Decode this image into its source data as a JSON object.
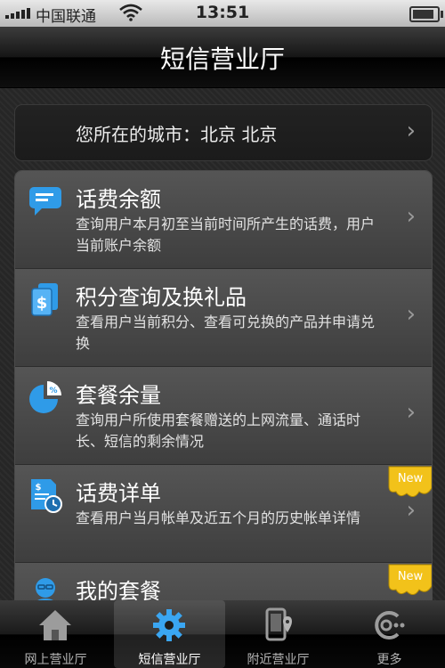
{
  "status_bar": {
    "carrier": "中国联通",
    "time": "13:51",
    "battery_level": 0.95
  },
  "nav": {
    "title": "短信营业厅"
  },
  "city": {
    "label": "您所在的城市：北京  北京"
  },
  "menu": [
    {
      "title": "话费余额",
      "desc": "查询用户本月初至当前时间所产生的话费，用户当前账户余额",
      "icon": "chat-bubble-icon",
      "new": false
    },
    {
      "title": "积分查询及换礼品",
      "desc": "查看用户当前积分、查看可兑换的产品并申请兑换",
      "icon": "dollar-cards-icon",
      "new": false
    },
    {
      "title": "套餐余量",
      "desc": "查询用户所使用套餐赠送的上网流量、通话时长、短信的剩余情况",
      "icon": "pie-chart-icon",
      "new": false
    },
    {
      "title": "话费详单",
      "desc": "查看用户当月帐单及近五个月的历史帐单详情",
      "icon": "bill-clock-icon",
      "new": true
    },
    {
      "title": "我的套餐",
      "desc": "",
      "icon": "user-avatar-icon",
      "new": true
    }
  ],
  "new_badge_text": "New",
  "tabs": [
    {
      "label": "网上营业厅",
      "icon": "home-icon",
      "active": false
    },
    {
      "label": "短信营业厅",
      "icon": "gear-icon",
      "active": true
    },
    {
      "label": "附近营业厅",
      "icon": "phone-location-icon",
      "active": false
    },
    {
      "label": "更多",
      "icon": "more-icon",
      "active": false
    }
  ],
  "colors": {
    "accent_blue": "#2f9be8",
    "badge_yellow": "#f2c21a"
  }
}
